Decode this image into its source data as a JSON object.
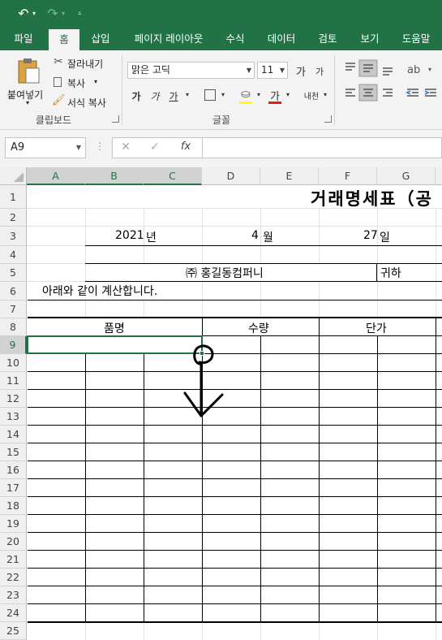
{
  "qat": {
    "undo_icon": "undo-icon",
    "redo_icon": "redo-icon",
    "customize_icon": "customize-qat-icon"
  },
  "tabs": [
    "파일",
    "홈",
    "삽입",
    "페이지 레이아웃",
    "수식",
    "데이터",
    "검토",
    "보기",
    "도움말"
  ],
  "ribbon": {
    "clipboard": {
      "paste": "붙여넣기",
      "cut": "잘라내기",
      "copy": "복사",
      "format_painter": "서식 복사",
      "label": "클립보드"
    },
    "font": {
      "name": "맑은 고딕",
      "size": "11",
      "increase": "가",
      "decrease": "가",
      "bold": "가",
      "italic": "가",
      "underline": "가",
      "font_color": "가",
      "phonetic": "내천",
      "label": "글꼴"
    }
  },
  "formula_bar": {
    "name_box": "A9",
    "fx": "fx",
    "cancel_icon": "cancel-icon",
    "enter_icon": "enter-icon",
    "value": ""
  },
  "columns": [
    "A",
    "B",
    "C",
    "D",
    "E",
    "F",
    "G"
  ],
  "rows": [
    "1",
    "2",
    "3",
    "4",
    "5",
    "6",
    "7",
    "8",
    "9",
    "10",
    "11",
    "12",
    "13",
    "14",
    "15",
    "16",
    "17",
    "18",
    "19",
    "20",
    "21",
    "22",
    "23",
    "24",
    "25"
  ],
  "sheet": {
    "title": "거래명세표（공",
    "year": "2021",
    "year_unit": "년",
    "month": "4",
    "month_unit": "월",
    "day": "27",
    "day_unit": "일",
    "company": "㈜ 홍길동컴퍼니",
    "honorific": "귀하",
    "note": "아래와 같이 계산합니다.",
    "hdr_item": "품명",
    "hdr_qty": "수량",
    "hdr_price": "단가"
  },
  "selected_cell": "A9",
  "colors": {
    "accent": "#217346",
    "selected_header": "#d2d2d2"
  }
}
